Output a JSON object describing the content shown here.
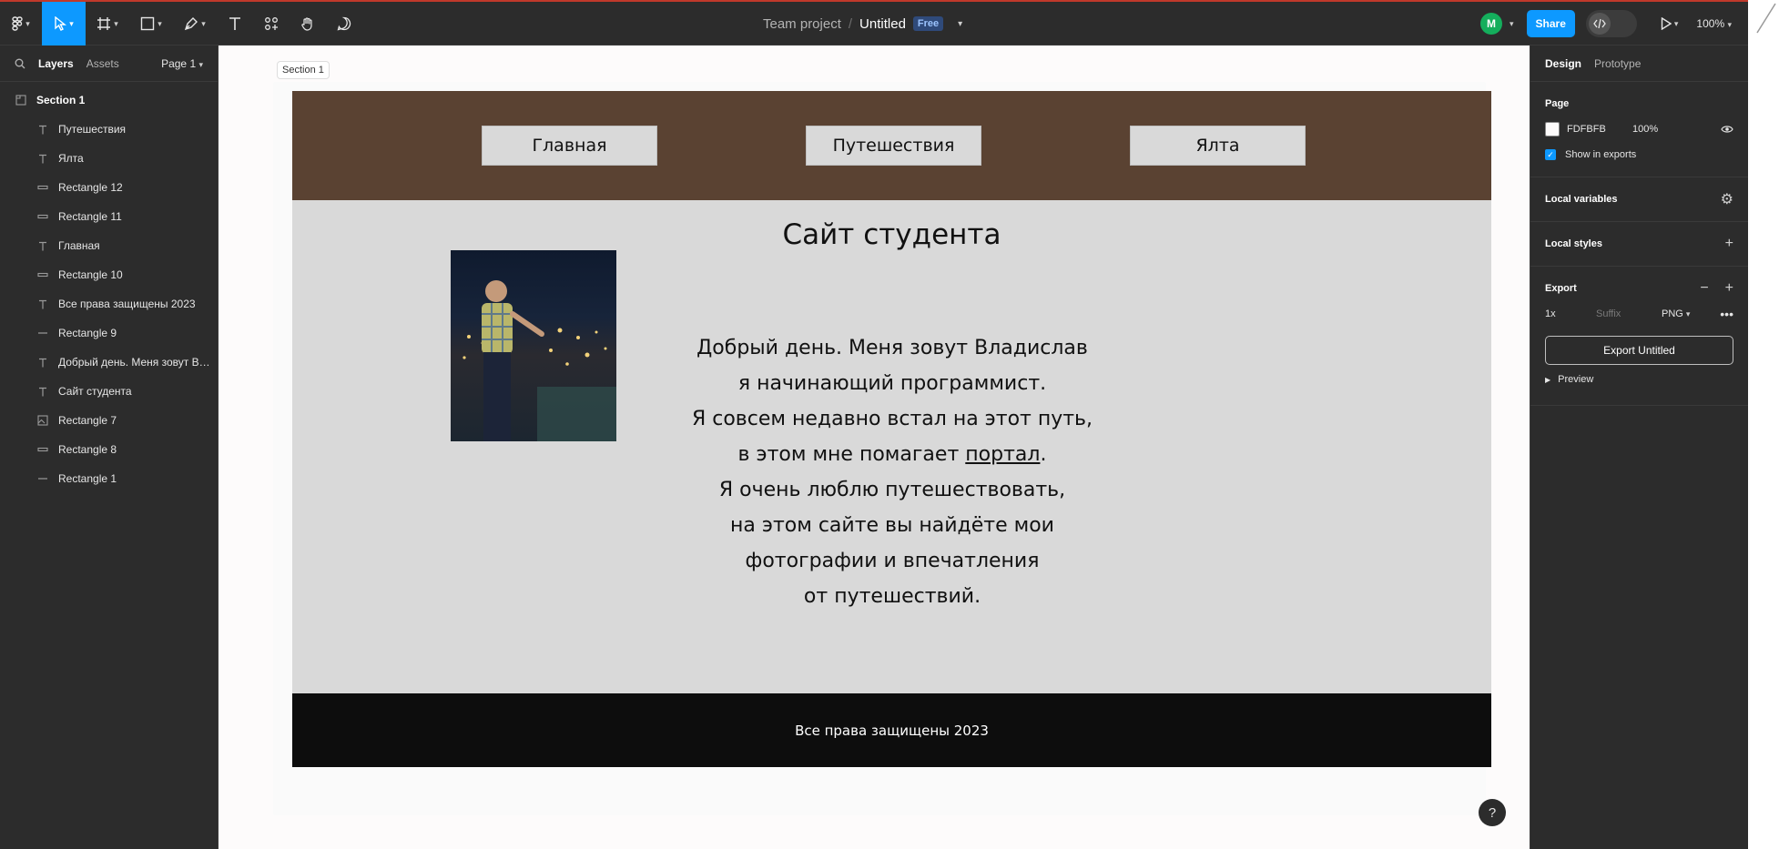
{
  "toolbar": {
    "project": "Team project",
    "separator": "/",
    "file_name": "Untitled",
    "plan_badge": "Free",
    "avatar_initial": "M",
    "share_label": "Share",
    "zoom": "100%"
  },
  "left_panel": {
    "tab_layers": "Layers",
    "tab_assets": "Assets",
    "page_selector": "Page 1",
    "layers": [
      {
        "name": "Section 1",
        "type": "section"
      },
      {
        "name": "Путешествия",
        "type": "text"
      },
      {
        "name": "Ялта",
        "type": "text"
      },
      {
        "name": "Rectangle 12",
        "type": "rect"
      },
      {
        "name": "Rectangle 11",
        "type": "rect"
      },
      {
        "name": "Главная",
        "type": "text"
      },
      {
        "name": "Rectangle 10",
        "type": "rect"
      },
      {
        "name": "Все права защищены 2023",
        "type": "text"
      },
      {
        "name": "Rectangle 9",
        "type": "line"
      },
      {
        "name": "Добрый день. Меня зовут Вл...",
        "type": "text"
      },
      {
        "name": "Сайт студента",
        "type": "text"
      },
      {
        "name": "Rectangle 7",
        "type": "image"
      },
      {
        "name": "Rectangle 8",
        "type": "rect"
      },
      {
        "name": "Rectangle 1",
        "type": "line"
      }
    ]
  },
  "canvas": {
    "section_label": "Section 1",
    "nav": [
      "Главная",
      "Путешествия",
      "Ялта"
    ],
    "site_title": "Сайт студента",
    "intro_lines": [
      "Добрый день. Меня зовут Владислав",
      "я начинающий программист.",
      "Я совсем недавно встал на этот путь,",
      "в этом мне помагает",
      "Я очень люблю путешествовать,",
      "на этом сайте вы найдёте мои",
      "фотографии и впечатления",
      "от путешествий."
    ],
    "intro_link": "портал",
    "intro_link_after": ".",
    "footer": "Все права защищены 2023",
    "colors": {
      "header": "#5a4232",
      "main": "#d9d9d9",
      "footer": "#0d0d0d",
      "canvas_bg": "#fdfbfb"
    }
  },
  "right_panel": {
    "tab_design": "Design",
    "tab_prototype": "Prototype",
    "page_heading": "Page",
    "page_color_hex": "FDFBFB",
    "page_opacity": "100%",
    "show_in_exports": "Show in exports",
    "local_variables": "Local variables",
    "local_styles": "Local styles",
    "export_heading": "Export",
    "export_scale": "1x",
    "export_suffix_placeholder": "Suffix",
    "export_format": "PNG",
    "export_button": "Export Untitled",
    "preview": "Preview"
  },
  "help": "?"
}
